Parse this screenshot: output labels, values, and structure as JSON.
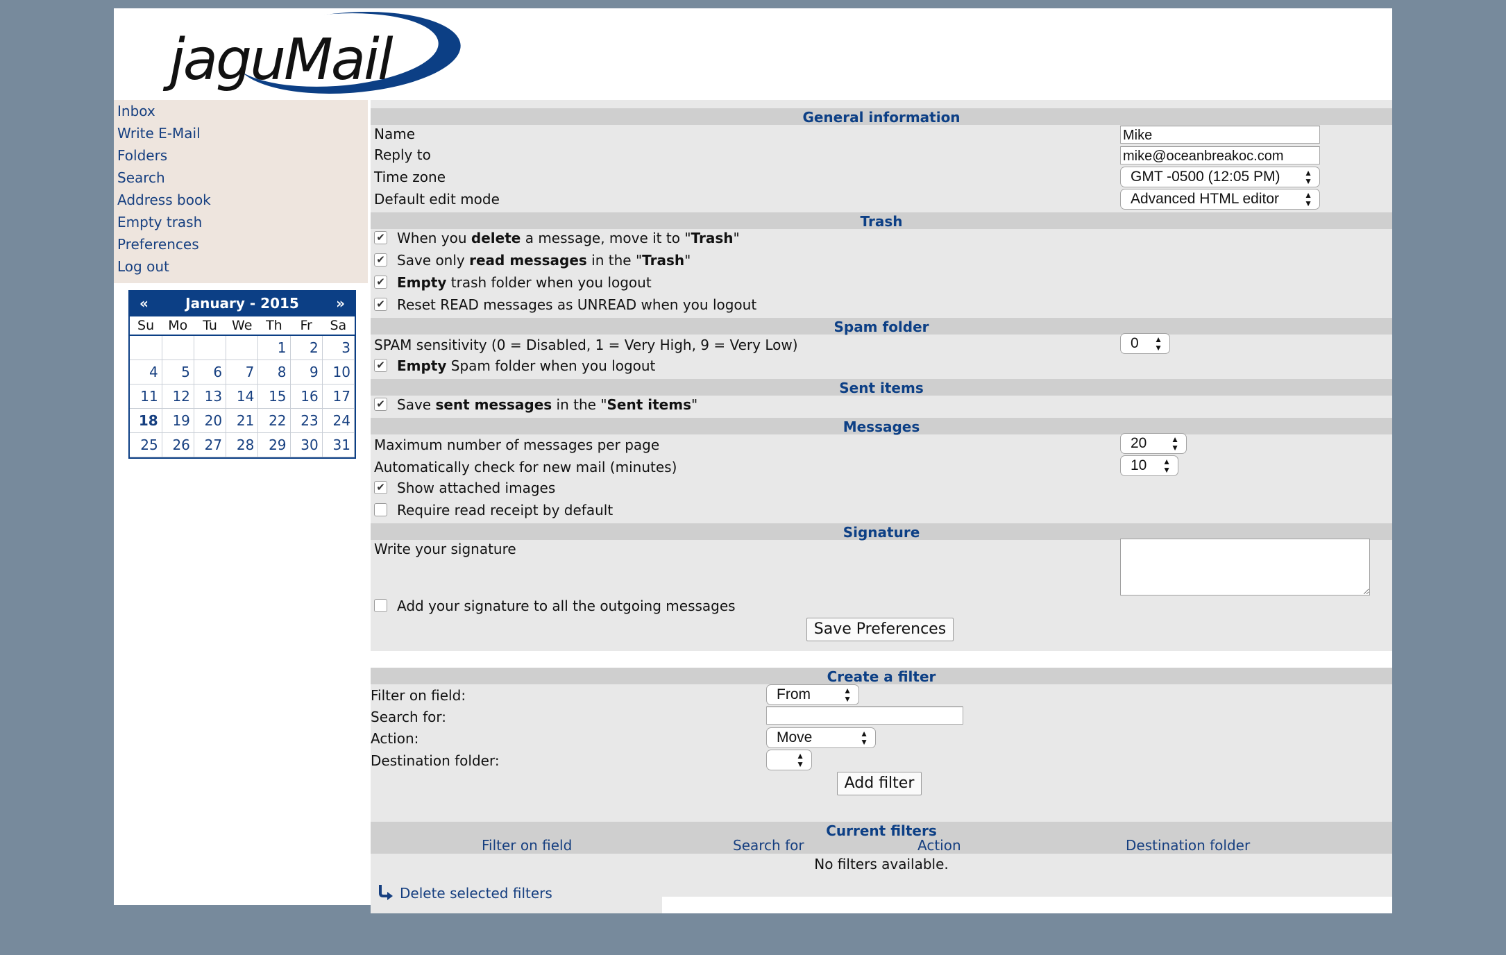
{
  "logo": {
    "text": "jaguMail"
  },
  "sidebar": {
    "items": [
      {
        "label": "Inbox"
      },
      {
        "label": "Write E-Mail"
      },
      {
        "label": "Folders"
      },
      {
        "label": "Search"
      },
      {
        "label": "Address book"
      },
      {
        "label": "Empty trash"
      },
      {
        "label": "Preferences"
      },
      {
        "label": "Log out"
      }
    ]
  },
  "calendar": {
    "title": "January - 2015",
    "prev": "«",
    "next": "»",
    "weekdays": [
      "Su",
      "Mo",
      "Tu",
      "We",
      "Th",
      "Fr",
      "Sa"
    ],
    "weeks": [
      [
        "",
        "",
        "",
        "",
        "1",
        "2",
        "3"
      ],
      [
        "4",
        "5",
        "6",
        "7",
        "8",
        "9",
        "10"
      ],
      [
        "11",
        "12",
        "13",
        "14",
        "15",
        "16",
        "17"
      ],
      [
        "18",
        "19",
        "20",
        "21",
        "22",
        "23",
        "24"
      ],
      [
        "25",
        "26",
        "27",
        "28",
        "29",
        "30",
        "31"
      ]
    ],
    "today": "18"
  },
  "general": {
    "title": "General information",
    "name_label": "Name",
    "name_value": "Mike",
    "reply_label": "Reply to",
    "reply_value": "mike@oceanbreakoc.com",
    "timezone_label": "Time zone",
    "timezone_value": "GMT -0500 (12:05 PM)",
    "editmode_label": "Default edit mode",
    "editmode_value": "Advanced HTML editor"
  },
  "trash": {
    "title": "Trash",
    "opt1_a": "When you ",
    "opt1_b": "delete",
    "opt1_c": " a message, move it to \"",
    "opt1_d": "Trash",
    "opt1_e": "\"",
    "opt2_a": "Save only ",
    "opt2_b": "read messages",
    "opt2_c": " in the \"",
    "opt2_d": "Trash",
    "opt2_e": "\"",
    "opt3_a": "Empty",
    "opt3_b": " trash folder when you logout",
    "opt4": "Reset READ messages as UNREAD when you logout"
  },
  "spam": {
    "title": "Spam folder",
    "sensitivity_label": "SPAM sensitivity (0 = Disabled, 1 = Very High, 9 = Very Low)",
    "sensitivity_value": "0",
    "empty_a": "Empty",
    "empty_b": " Spam folder when you logout"
  },
  "sent": {
    "title": "Sent items",
    "opt_a": "Save ",
    "opt_b": "sent messages",
    "opt_c": " in the \"",
    "opt_d": "Sent items",
    "opt_e": "\""
  },
  "messages": {
    "title": "Messages",
    "perpage_label": "Maximum number of messages per page",
    "perpage_value": "20",
    "check_label": "Automatically check for new mail (minutes)",
    "check_value": "10",
    "images_label": "Show attached images",
    "receipt_label": "Require read receipt by default"
  },
  "signature": {
    "title": "Signature",
    "write_label": "Write your signature",
    "add_label": "Add your signature to all the outgoing messages",
    "save_button": "Save Preferences"
  },
  "filter": {
    "title": "Create a filter",
    "field_label": "Filter on field:",
    "field_value": "From",
    "search_label": "Search for:",
    "action_label": "Action:",
    "action_value": "Move",
    "dest_label": "Destination folder:",
    "add_button": "Add filter"
  },
  "current": {
    "title": "Current filters",
    "col_field": "Filter on field",
    "col_search": "Search for",
    "col_action": "Action",
    "col_dest": "Destination folder",
    "empty": "No filters available.",
    "delete_link": "Delete selected filters"
  },
  "colors": {
    "background": "#778a9c",
    "accent": "#0c3f85",
    "sidebar": "#eee5de",
    "panel": "#e8e8e8",
    "header": "#cfcfcf"
  }
}
